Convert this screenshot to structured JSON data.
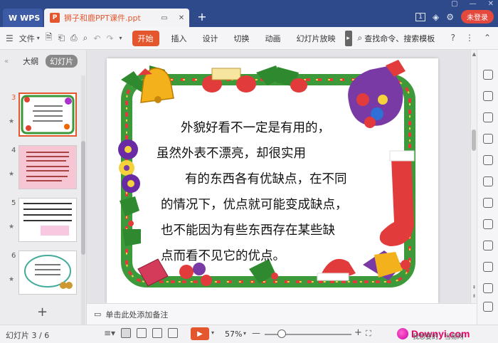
{
  "titlebar": {
    "app_name": "WPS",
    "doc_tab": "狮子和鹿PPT课件.ppt",
    "new_tab": "+",
    "login": "未登录",
    "badge": "1"
  },
  "ribbon": {
    "file_menu": "文件",
    "tabs": [
      "开始",
      "插入",
      "设计",
      "切换",
      "动画",
      "幻灯片放映"
    ],
    "active_tab": "开始",
    "more": "▸",
    "search": "查找命令、搜索模板",
    "help": "?"
  },
  "left_panel": {
    "tab_outline": "大纲",
    "tab_slides": "幻灯片",
    "add_slide": "+",
    "thumbs": [
      {
        "num": "3",
        "active": true
      },
      {
        "num": "4",
        "active": false
      },
      {
        "num": "5",
        "active": false
      },
      {
        "num": "6",
        "active": false
      }
    ]
  },
  "slide": {
    "lines": [
      "外貌好看不一定是有用的，",
      "虽然外表不漂亮，却很实用",
      "有的东西各有优缺点，在不同",
      "的情况下，优点就可能变成缺点，",
      "也不能因为有些东西存在某些缺",
      "点而看不见它的优点。"
    ]
  },
  "notes": {
    "placeholder": "单击此处添加备注"
  },
  "statusbar": {
    "slide_indicator": "幻灯片 3 / 6",
    "zoom": "57%",
    "zoom_level": 0.2,
    "minus": "—",
    "plus": "+"
  },
  "watermark": {
    "text": "Downyi.com",
    "sub": "我想要的 · 当易网"
  },
  "colors": {
    "accent": "#e4572e",
    "titlebar": "#2f4a8a"
  }
}
